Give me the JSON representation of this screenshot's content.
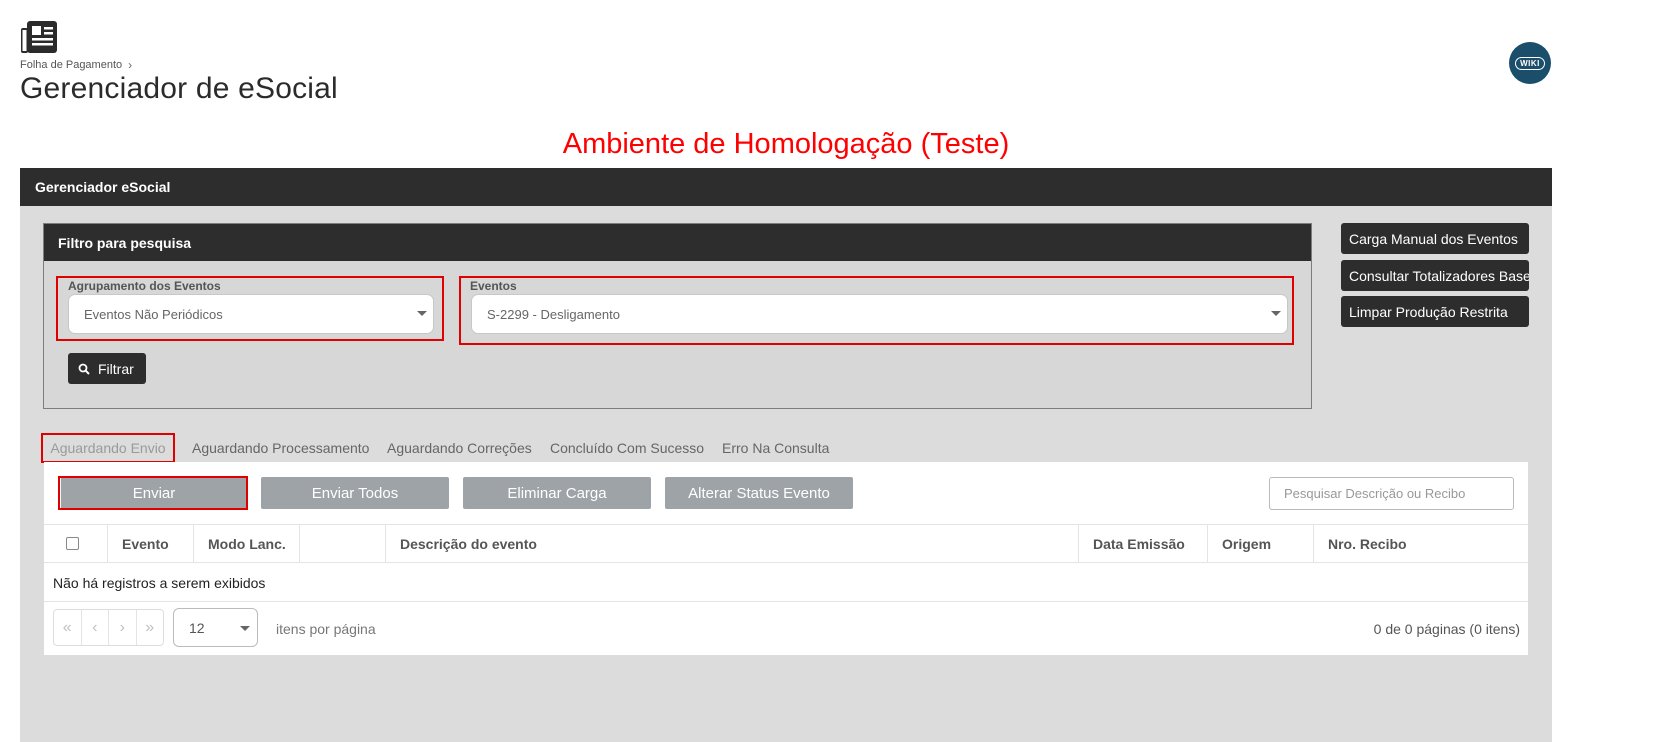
{
  "header": {
    "breadcrumb": "Folha de Pagamento",
    "title": "Gerenciador de eSocial",
    "wiki_label": "WIKI"
  },
  "environment_banner": "Ambiente de Homologação (Teste)",
  "panel": {
    "title": "Gerenciador eSocial",
    "filter": {
      "title": "Filtro para pesquisa",
      "grouping_label": "Agrupamento dos Eventos",
      "grouping_value": "Eventos Não Periódicos",
      "events_label": "Eventos",
      "events_value": "S-2299 - Desligamento",
      "filter_button": "Filtrar"
    },
    "side_buttons": [
      "Carga Manual dos Eventos",
      "Consultar Totalizadores Base",
      "Limpar Produção Restrita"
    ],
    "tabs": [
      "Aguardando Envio",
      "Aguardando Processamento",
      "Aguardando Correções",
      "Concluído Com Sucesso",
      "Erro Na Consulta"
    ],
    "actions": [
      "Enviar",
      "Enviar Todos",
      "Eliminar Carga",
      "Alterar Status Evento"
    ],
    "search_placeholder": "Pesquisar Descrição ou Recibo",
    "grid": {
      "columns": [
        "Evento",
        "Modo Lanc.",
        "",
        "Descrição do evento",
        "Data Emissão",
        "Origem",
        "Nro. Recibo"
      ],
      "empty_message": "Não há registros a serem exibidos"
    },
    "pager": {
      "page_size": "12",
      "per_page_label": "itens por página",
      "info": "0 de 0 páginas (0 itens)"
    }
  },
  "colors": {
    "banner": "#ff0000",
    "dark_header": "#2d2d2d",
    "highlight_border": "#e00000",
    "gray_button": "#9ea3a8"
  }
}
